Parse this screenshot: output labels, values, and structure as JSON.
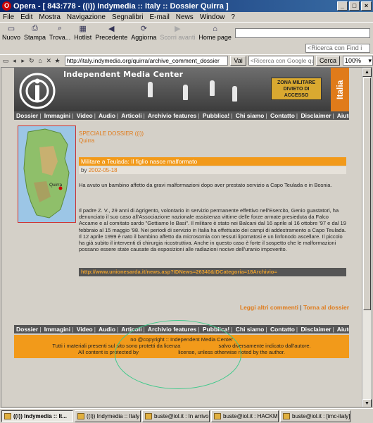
{
  "window": {
    "title": "Opera - [ 843:778 - ((i)) Indymedia :: Italy :: Dossier Quirra ]",
    "controls": [
      "_",
      "□",
      "×"
    ]
  },
  "menu": [
    "File",
    "Edit",
    "Mostra",
    "Navigazione",
    "Segnalibri",
    "E-mail",
    "News",
    "Window",
    "?"
  ],
  "toolbar": {
    "buttons": [
      {
        "label": "Nuovo",
        "icon": "new-page-icon"
      },
      {
        "label": "Stampa",
        "icon": "print-icon"
      },
      {
        "label": "Trova...",
        "icon": "find-icon"
      },
      {
        "label": "Hotlist",
        "icon": "hotlist-icon"
      },
      {
        "label": "Precedente",
        "icon": "back-icon"
      },
      {
        "label": "Aggiorna",
        "icon": "reload-icon"
      },
      {
        "label": "Scorri avanti",
        "icon": "forward-icon",
        "disabled": true
      },
      {
        "label": "Home page",
        "icon": "home-icon"
      }
    ],
    "find_placeholder": "<Ricerca con Find i"
  },
  "address": {
    "url": "http://italy.indymedia.org/quirra/archive_comment_dossier",
    "go_label": "Vai",
    "search_placeholder": "<Ricerca con Google qui>",
    "search_label": "Cerca",
    "zoom": "100%"
  },
  "site": {
    "banner_title": "Independent Media Center",
    "sign_text": "ZONA MILITARE DIVIETO DI ACCESSO",
    "side_tab": "Italia",
    "nav": [
      "Dossier",
      "Immagini",
      "Video",
      "Audio",
      "Articoli",
      "Archivio features",
      "Pubblica!",
      "Chi siamo",
      "Contatto",
      "Disclaimer",
      "Aiuto"
    ],
    "map_label": "Quirra",
    "special_line1": "SPECIALE DOSSIER ((i))",
    "special_line2": "Quirra",
    "article_title": "Militare a Teulada: Il figlio nasce malformato",
    "byline_prefix": "by",
    "byline_author": "",
    "byline_date": "2002-05-18",
    "para1": "Ha avuto un bambino affetto da gravi malformazioni dopo aver prestato servizio a Capo Teulada e in Bosnia.",
    "para2": "Il padre Z. V., 29 anni di Agrigento, volontario in servizio permanente effettivo nell'Esercito, Genio guastatori, ha denunciato il suo caso all'Associazione nazionale assistenza vittime delle forze armate presieduta da Falco Accame e al comitato sardo \"Gettiamo le Basi\". Il militare è stato nei Balcani dal 16 aprile al 16 ottobre '97 e dal 19 febbraio al 15 maggio '98. Nei periodi di servizio in Italia ha effettuato dei campi di addestramento a Capo Teulada. Il 12 aprile 1999 è nato il bambino affetto da microsomia con tessuti lipomatosi e un linfonodo ascellare. Il piccolo ha già subito il interventi di chirurgia ricostruttiva. Anche in questo caso è forte il sospetto che le malformazioni possano essere state causate da esposizioni alle radiazioni nocive dell'uranio impoverito.",
    "source_link": "http://www.unionesarda.it/news.asp?IDNews=26340&IDCategoria=18Archivio=",
    "more_comments": "Leggi altri commenti",
    "back_to_dossier": "Torna al dossier",
    "footer_line1": "no @copyright :: Independent Media Center",
    "footer_line2": "Tutti i materiali presenti sul sito sono protetti da licenza                          salvo diversamente indicato dall'autore.",
    "footer_line3": "All content is protected by                           license, unless otherwise noted by the author."
  },
  "taskbar": [
    {
      "label": "((i)) Indymedia :: It...",
      "active": true
    },
    {
      "label": "((i)) Indymedia :: Italy ::...",
      "active": false
    },
    {
      "label": "buste@iol.it : In arrivo",
      "active": false
    },
    {
      "label": "buste@iol.it : HACKM...",
      "active": false
    },
    {
      "label": "buste@iol.it : [imc-italy]",
      "active": false
    }
  ]
}
